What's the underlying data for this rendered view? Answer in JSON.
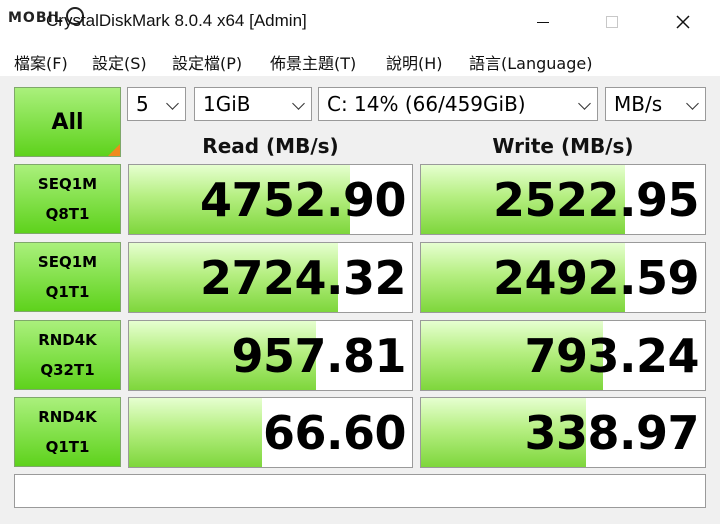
{
  "window": {
    "logo_text": "MOBILE",
    "title": "CrystalDiskMark 8.0.4 x64 [Admin]"
  },
  "menu": [
    "檔案(F)",
    "設定(S)",
    "設定檔(P)",
    "佈景主題(T)",
    "說明(H)",
    "語言(Language)"
  ],
  "controls": {
    "all_label": "All",
    "count": "5",
    "size": "1GiB",
    "drive": "C: 14% (66/459GiB)",
    "unit": "MB/s"
  },
  "headers": {
    "read": "Read (MB/s)",
    "write": "Write (MB/s)"
  },
  "tests": [
    {
      "line1": "SEQ1M",
      "line2": "Q8T1",
      "read": "4752.90",
      "write": "2522.95",
      "read_fill": 0.78,
      "write_fill": 0.72
    },
    {
      "line1": "SEQ1M",
      "line2": "Q1T1",
      "read": "2724.32",
      "write": "2492.59",
      "read_fill": 0.74,
      "write_fill": 0.72
    },
    {
      "line1": "RND4K",
      "line2": "Q32T1",
      "read": "957.81",
      "write": "793.24",
      "read_fill": 0.66,
      "write_fill": 0.64
    },
    {
      "line1": "RND4K",
      "line2": "Q1T1",
      "read": "66.60",
      "write": "338.97",
      "read_fill": 0.47,
      "write_fill": 0.58
    }
  ],
  "comment": "",
  "colors": {
    "bar": "#7ed63c",
    "label_bg": "#5ed21c",
    "corner_marker": "#f08a1c"
  }
}
